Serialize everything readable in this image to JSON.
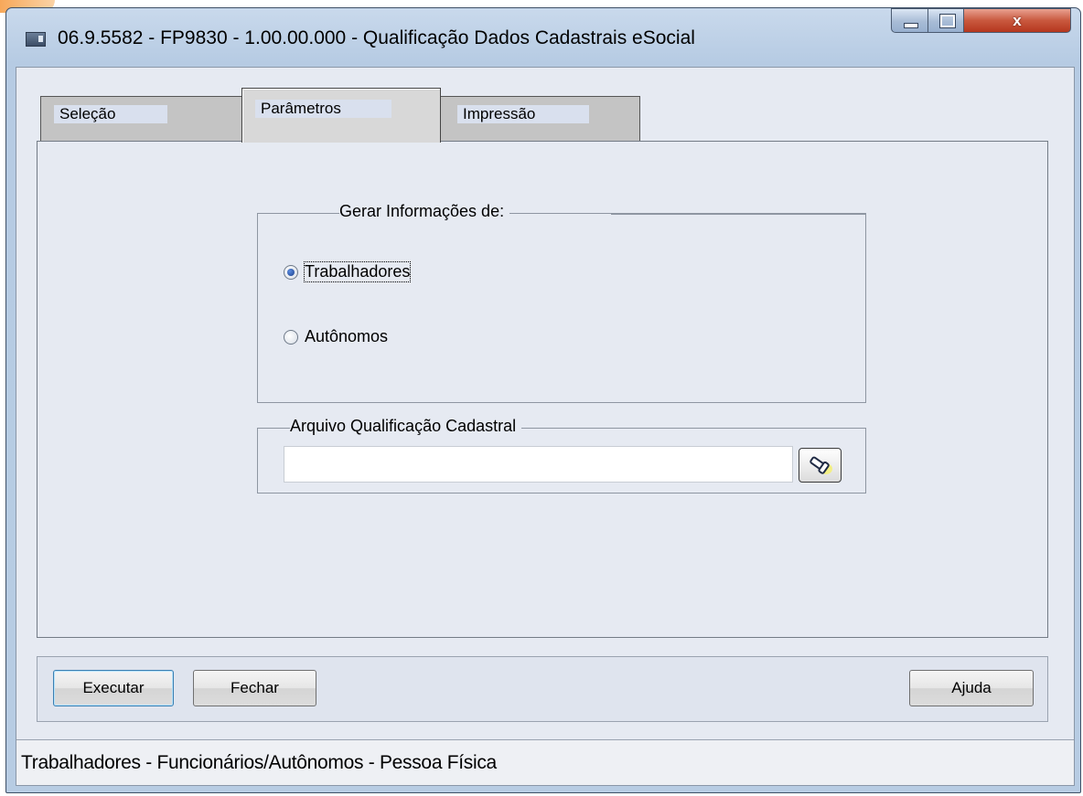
{
  "window": {
    "title": "06.9.5582 - FP9830 - 1.00.00.000 - Qualificação Dados Cadastrais eSocial",
    "close_label": "x"
  },
  "tabs": [
    {
      "label": "Seleção",
      "selected": false
    },
    {
      "label": "Parâmetros",
      "selected": true
    },
    {
      "label": "Impressão",
      "selected": false
    }
  ],
  "gerar_group": {
    "title": "Gerar Informações de:",
    "options": [
      {
        "label": "Trabalhadores",
        "selected": true
      },
      {
        "label": "Autônomos",
        "selected": false
      }
    ]
  },
  "arquivo_group": {
    "title": "Arquivo Qualificação Cadastral",
    "value": "",
    "placeholder": "",
    "browse_icon": "flashlight-search-icon"
  },
  "buttons": {
    "executar": "Executar",
    "fechar": "Fechar",
    "ajuda": "Ajuda"
  },
  "status": {
    "text": "Trabalhadores - Funcionários/Autônomos - Pessoa Física"
  }
}
